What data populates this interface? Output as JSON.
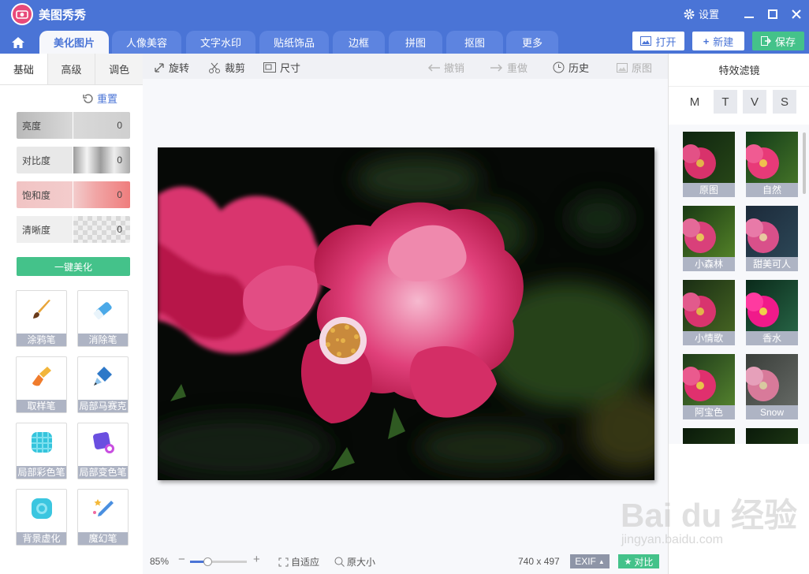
{
  "app": {
    "title": "美图秀秀",
    "settings_label": "设置",
    "accent": "#4a74d6",
    "green": "#44c28a"
  },
  "tabs": [
    "美化图片",
    "人像美容",
    "文字水印",
    "贴纸饰品",
    "边框",
    "拼图",
    "抠图",
    "更多"
  ],
  "top_actions": {
    "open": "打开",
    "new": "新建",
    "save": "保存"
  },
  "left": {
    "subtabs": [
      "基础",
      "高级",
      "调色"
    ],
    "reset_label": "重置",
    "sliders": [
      {
        "label": "亮度",
        "value": "0"
      },
      {
        "label": "对比度",
        "value": "0"
      },
      {
        "label": "饱和度",
        "value": "0"
      },
      {
        "label": "清晰度",
        "value": "0"
      }
    ],
    "one_key": "一键美化",
    "tools": [
      {
        "name": "涂鸦笔",
        "icon": "brush-icon"
      },
      {
        "name": "消除笔",
        "icon": "eraser-icon"
      },
      {
        "name": "取样笔",
        "icon": "sample-brush-icon"
      },
      {
        "name": "局部马赛克",
        "icon": "mosaic-pen-icon"
      },
      {
        "name": "局部彩色笔",
        "icon": "color-pen-icon"
      },
      {
        "name": "局部变色笔",
        "icon": "recolor-pen-icon"
      },
      {
        "name": "背景虚化",
        "icon": "blur-icon"
      },
      {
        "name": "魔幻笔",
        "icon": "magic-pen-icon"
      }
    ]
  },
  "edit_toolbar": {
    "rotate": "旋转",
    "crop": "裁剪",
    "size": "尺寸",
    "undo": "撤销",
    "redo": "重做",
    "history": "历史",
    "original": "原图"
  },
  "bottom": {
    "zoom": "85%",
    "fit": "自适应",
    "actual": "原大小",
    "dimensions": "740 x 497",
    "exif": "EXIF",
    "compare": "对比",
    "zoom_level": 0.3
  },
  "right": {
    "title": "特效滤镜",
    "categories": [
      "M",
      "T",
      "V",
      "S"
    ],
    "selected_category": "T",
    "filters": [
      "原图",
      "自然",
      "小森林",
      "甜美可人",
      "小情歌",
      "香水",
      "阿宝色",
      "Snow"
    ]
  },
  "watermark": {
    "text": "Bai du 经验",
    "sub": "jingyan.baidu.com"
  }
}
